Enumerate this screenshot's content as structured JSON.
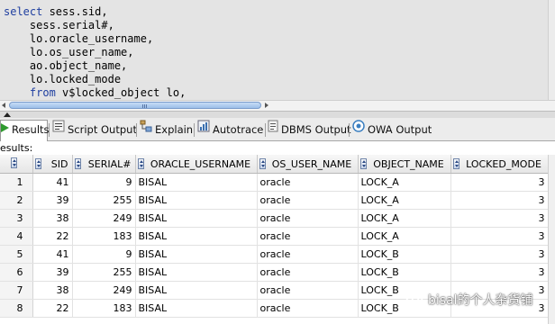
{
  "editor": {
    "sql": [
      "select sess.sid,",
      "    sess.serial#,",
      "    lo.oracle_username,",
      "    lo.os_user_name,",
      "    ao.object_name,",
      "    lo.locked_mode",
      "    from v$locked_object lo,"
    ],
    "keyword_color": "#1e3ea0"
  },
  "tabs": [
    {
      "label": "Results",
      "icon": "green-play-icon",
      "active": true
    },
    {
      "label": "Script Output",
      "icon": "script-output-icon",
      "active": false
    },
    {
      "label": "Explain",
      "icon": "explain-plan-icon",
      "active": false
    },
    {
      "label": "Autotrace",
      "icon": "autotrace-icon",
      "active": false
    },
    {
      "label": "DBMS Output",
      "icon": "dbms-output-icon",
      "active": false
    },
    {
      "label": "OWA Output",
      "icon": "owa-output-icon",
      "active": false
    }
  ],
  "results_label": "esults:",
  "grid": {
    "columns": [
      "",
      "SID",
      "SERIAL#",
      "ORACLE_USERNAME",
      "OS_USER_NAME",
      "OBJECT_NAME",
      "LOCKED_MODE"
    ],
    "rows": [
      [
        "1",
        "41",
        "9",
        "BISAL",
        "oracle",
        "LOCK_A",
        "3"
      ],
      [
        "2",
        "39",
        "255",
        "BISAL",
        "oracle",
        "LOCK_A",
        "3"
      ],
      [
        "3",
        "38",
        "249",
        "BISAL",
        "oracle",
        "LOCK_A",
        "3"
      ],
      [
        "4",
        "22",
        "183",
        "BISAL",
        "oracle",
        "LOCK_A",
        "3"
      ],
      [
        "5",
        "41",
        "9",
        "BISAL",
        "oracle",
        "LOCK_B",
        "3"
      ],
      [
        "6",
        "39",
        "255",
        "BISAL",
        "oracle",
        "LOCK_B",
        "3"
      ],
      [
        "7",
        "38",
        "249",
        "BISAL",
        "oracle",
        "LOCK_B",
        "3"
      ],
      [
        "8",
        "22",
        "183",
        "BISAL",
        "oracle",
        "LOCK_B",
        "3"
      ]
    ]
  },
  "watermark": {
    "text": "bisal的个人杂货铺",
    "icon": "wechat-icon"
  }
}
